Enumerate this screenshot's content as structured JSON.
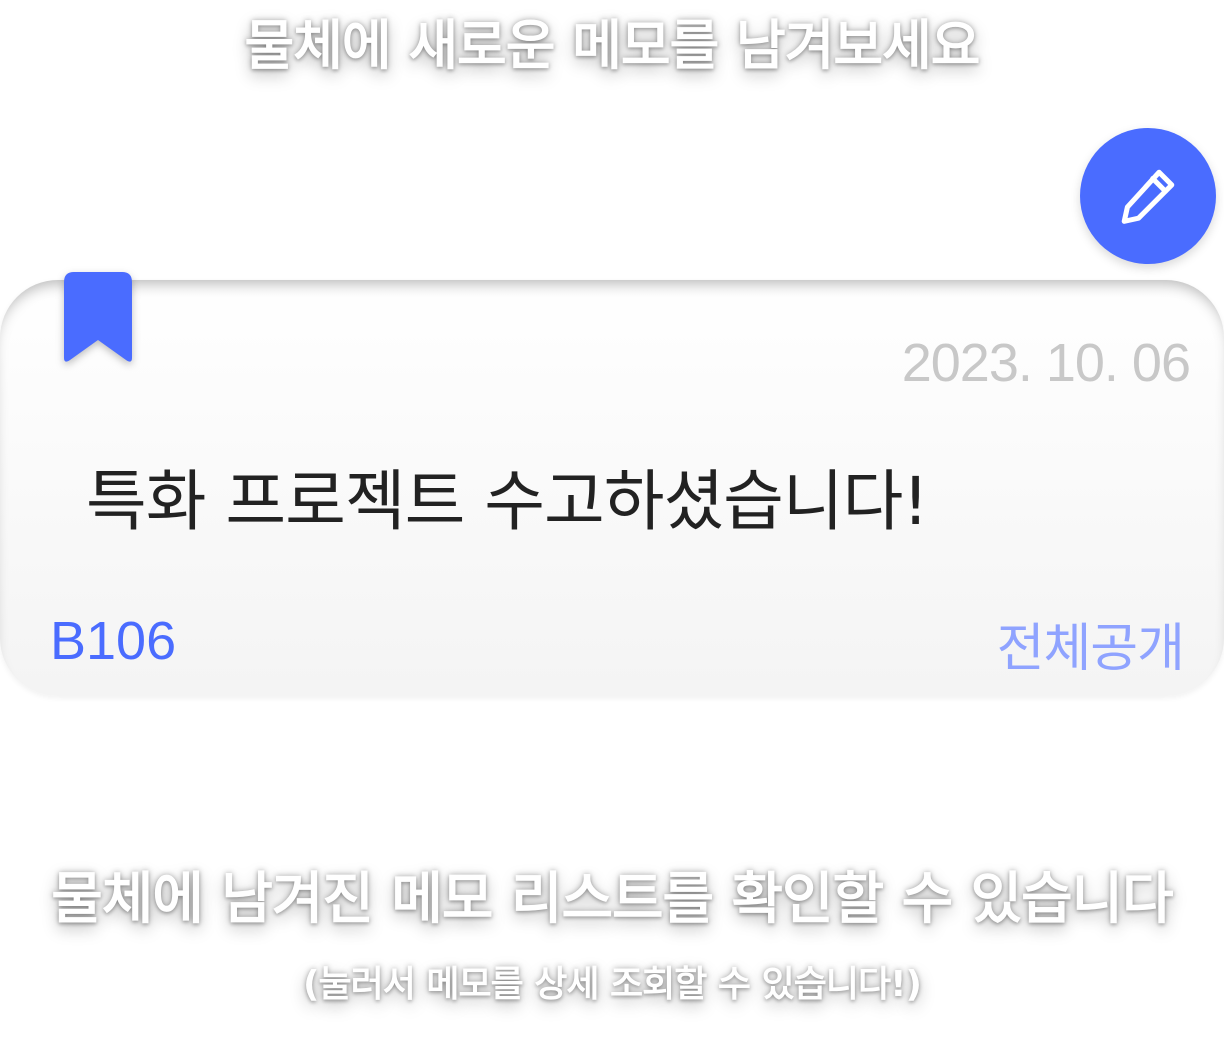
{
  "hints": {
    "top": "물체에 새로운 메모를 남겨보세요",
    "bottom_main": "물체에 남겨진 메모 리스트를 확인할 수 있습니다",
    "bottom_sub": "(눌러서 메모를 상세 조회할 수 있습니다!)"
  },
  "write_button": {
    "icon": "pencil-icon"
  },
  "memo": {
    "bookmark_icon": "bookmark-icon",
    "date": "2023. 10. 06",
    "content": "특화 프로젝트 수고하셨습니다!",
    "room": "B106",
    "visibility": "전체공개"
  },
  "colors": {
    "accent": "#4a6cff",
    "visibility_text": "#8fa3ff",
    "date_text": "#c8c8c8",
    "content_text": "#222222"
  }
}
